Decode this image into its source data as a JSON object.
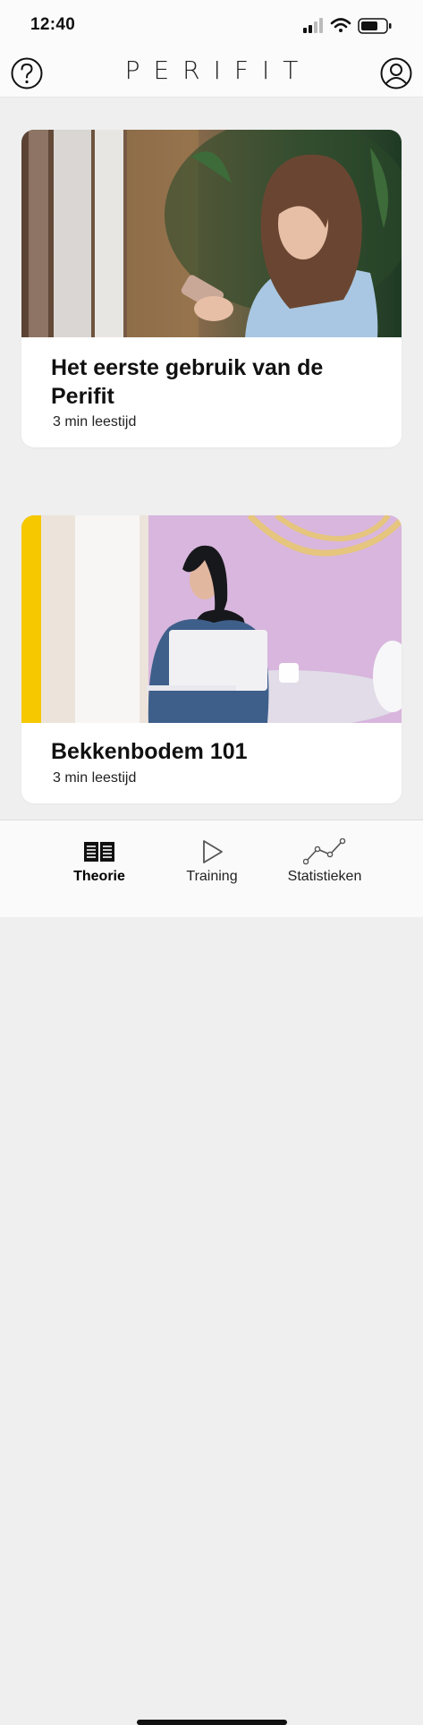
{
  "status": {
    "time": "12:40"
  },
  "header": {
    "logo": "PERIFIT"
  },
  "articles": [
    {
      "title": "Het eerste gebruik van de Perifit",
      "read_time": "3 min leestijd"
    },
    {
      "title": "Bekkenbodem 101",
      "read_time": "3 min leestijd"
    }
  ],
  "tabs": [
    {
      "label": "Theorie",
      "icon": "book-icon",
      "active": true
    },
    {
      "label": "Training",
      "icon": "play-icon",
      "active": false
    },
    {
      "label": "Statistieken",
      "icon": "chart-icon",
      "active": false
    }
  ],
  "colors": {
    "background": "#efefef",
    "card": "#ffffff",
    "accent_yellow": "#f5c800",
    "lilac": "#d7b3dc"
  }
}
